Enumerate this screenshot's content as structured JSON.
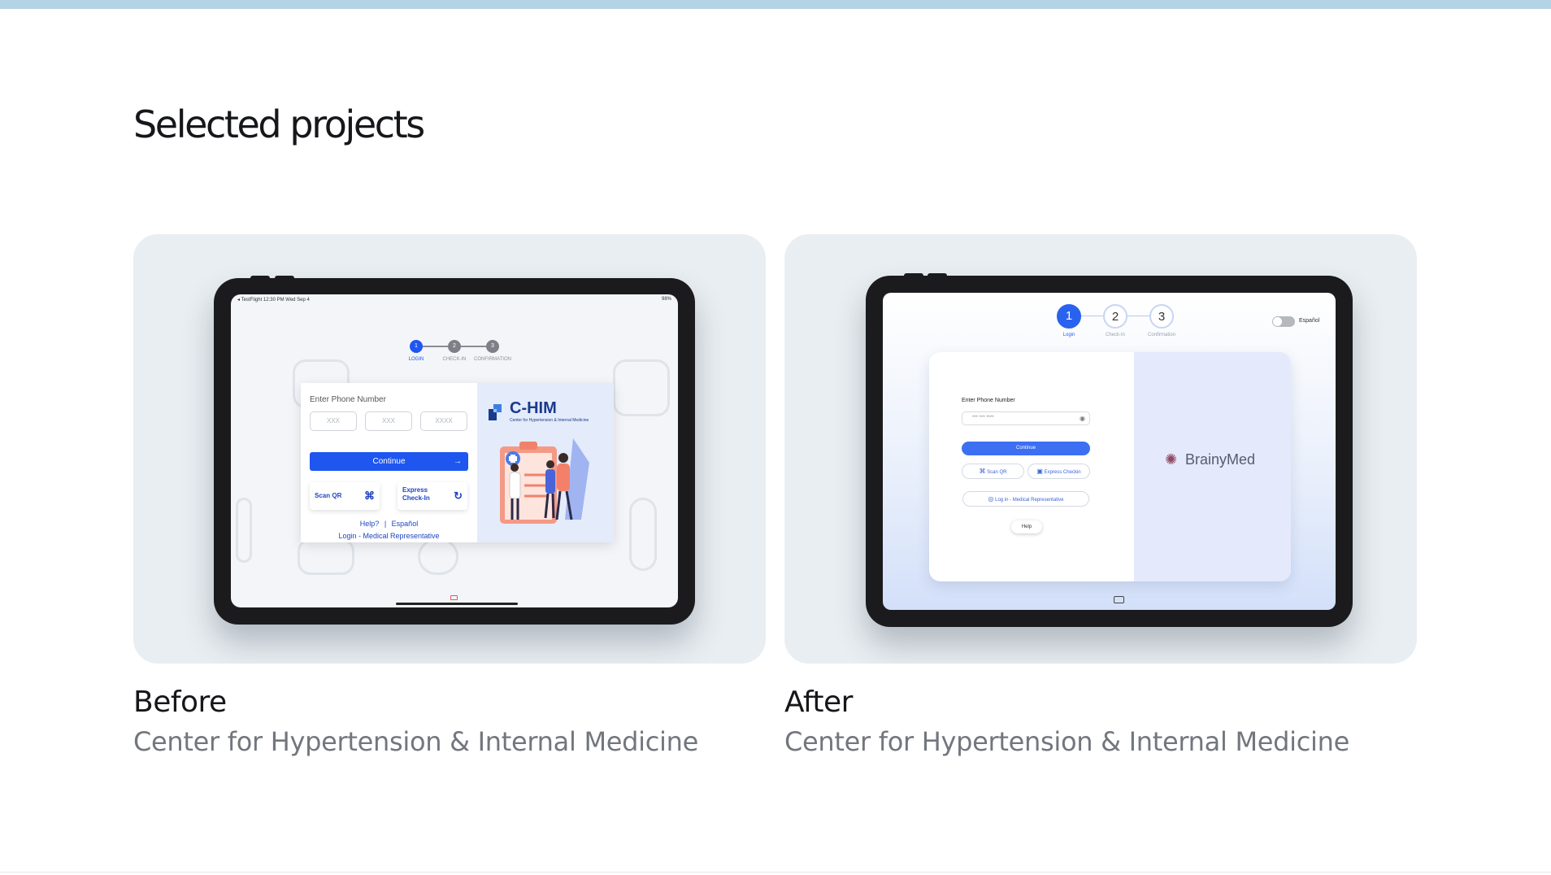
{
  "page": {
    "section_title": "Selected projects"
  },
  "projects": [
    {
      "caption_title": "Before",
      "caption_subtitle": "Center for Hypertension & Internal Medicine",
      "screen": {
        "status_left": "◂ TestFlight   12:30 PM   Wed Sep 4",
        "status_right": "98%",
        "steps": [
          {
            "number": "1",
            "label": "LOGIN"
          },
          {
            "number": "2",
            "label": "CHECK-IN"
          },
          {
            "number": "3",
            "label": "CONFIRMATION"
          }
        ],
        "phone_label": "Enter Phone Number",
        "phone_placeholders": [
          "XXX",
          "XXX",
          "XXXX"
        ],
        "continue_label": "Continue",
        "scan_qr_label": "Scan QR",
        "express_label_1": "Express",
        "express_label_2": "Check-In",
        "help_label": "Help?",
        "separator": "|",
        "espanol_label": "Español",
        "rep_login_label": "Login - Medical Representative",
        "logo_text": "C-HIM",
        "logo_subtitle": "Center for Hypertension & Internal Medicine"
      }
    },
    {
      "caption_title": "After",
      "caption_subtitle": "Center for Hypertension & Internal Medicine",
      "screen": {
        "steps": [
          {
            "number": "1",
            "label": "Login"
          },
          {
            "number": "2",
            "label": "Check-In"
          },
          {
            "number": "3",
            "label": "Confirmation"
          }
        ],
        "language_toggle_label": "Español",
        "phone_label": "Enter Phone Number",
        "phone_value": "*** *** ****",
        "continue_label": "Continue",
        "scan_qr_label": "Scan QR",
        "express_label": "Express Checkin",
        "rep_login_label": "Log in - Medical Representative",
        "help_label": "Help",
        "brand_name": "BrainyMed"
      }
    }
  ],
  "colors": {
    "top_bar": "#b4d3e7",
    "card_bg": "#e9eef2",
    "primary_blue": "#1f56f0",
    "after_blue": "#2a62f0",
    "brand_maroon": "#8f4961"
  }
}
